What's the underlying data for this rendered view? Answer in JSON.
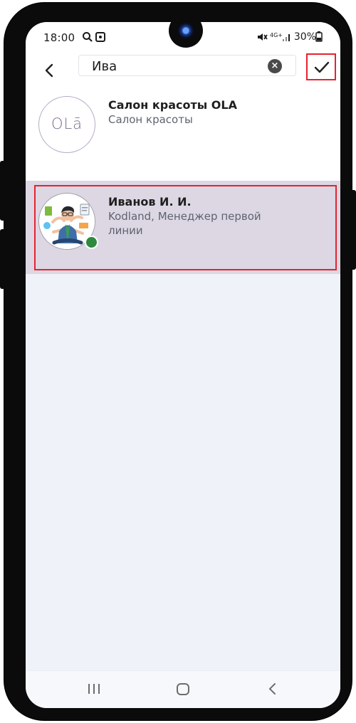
{
  "status_bar": {
    "time": "18:00",
    "network": "4G+",
    "battery": "30%"
  },
  "search": {
    "value": "Ива",
    "placeholder": ""
  },
  "contacts": [
    {
      "name": "Салон красоты OLA",
      "subtitle": "Салон красоты",
      "avatar_text": "OLā",
      "selected": false,
      "online": false
    },
    {
      "name": "Иванов И. И.",
      "subtitle": "Kodland, Менеджер первой линии",
      "selected": true,
      "online": true
    }
  ],
  "colors": {
    "accent": "#e52330",
    "selected_row": "#dcd7e3",
    "online": "#2e8a3e",
    "screen_background": "#eff2f8"
  },
  "icons": {
    "back": "chevron-left-icon",
    "clear": "clear-circle-icon",
    "confirm": "check-icon",
    "nav_recent": "recent-apps-icon",
    "nav_home": "home-icon",
    "nav_back": "nav-back-icon"
  }
}
